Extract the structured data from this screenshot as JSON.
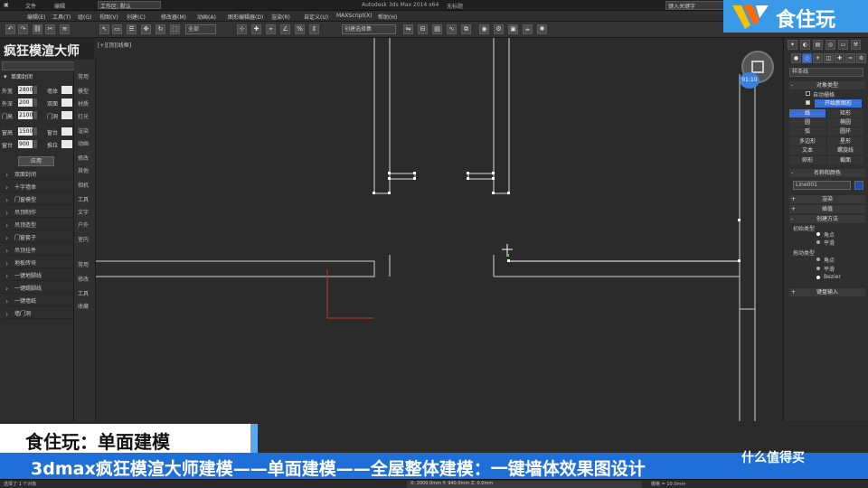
{
  "titlebar": {
    "menu_left": [
      "文件",
      "编辑"
    ],
    "workspace": "工作区: 默认",
    "app_title": "Autodesk 3ds Max 2014 x64",
    "doc_title": "无标题",
    "search_placeholder": "键入关键字"
  },
  "menubar": {
    "items": [
      "编辑(E)",
      "工具(T)",
      "组(G)",
      "视图(V)",
      "创建(C)",
      "修改器(M)",
      "动画(A)",
      "图形编辑器(D)",
      "渲染(R)",
      "自定义(U)",
      "MAXScript(X)",
      "帮助(H)"
    ]
  },
  "toolbar": {
    "selection_filter": "全部",
    "named_selection": "创建选择集"
  },
  "left_panel": {
    "title": "疯狂模渲大师",
    "section": "单面封闭",
    "fields": [
      {
        "l1": "外宽",
        "v1": "2800",
        "l2": "墙体",
        "v2": ""
      },
      {
        "l1": "外深",
        "v1": "200",
        "l2": "双面",
        "v2": ""
      },
      {
        "l1": "门高",
        "v1": "2100",
        "l2": "门洞",
        "v2": ""
      },
      {
        "l1": "窗高",
        "v1": "1500",
        "l2": "窗台",
        "v2": ""
      },
      {
        "l1": "窗台",
        "v1": "900",
        "l2": "推拉",
        "v2": ""
      }
    ],
    "apply_label": "应用",
    "collapsed": [
      "双面封闭",
      "十字墙体",
      "门窗模型",
      "吊顶制作",
      "吊顶造型",
      "门窗套子",
      "吊顶挂件",
      "地板砖块",
      "一键地脚线",
      "一键踢脚线",
      "一键墙纸",
      "墙门洞"
    ]
  },
  "side_column": {
    "items": [
      "常用",
      "模型",
      "材质",
      "灯光",
      "渲染",
      "动画",
      "修改",
      "其他",
      "相机",
      "工具",
      "文字",
      "户外",
      "室内",
      "常用",
      "修改",
      "工具",
      "收藏",
      "帮助"
    ]
  },
  "viewport": {
    "label": "[+][顶][线框]"
  },
  "command_panel": {
    "tabs": [
      "✦",
      "◐",
      "▤",
      "◎",
      "▭",
      "⚒"
    ],
    "object_type_dropdown": "样条线",
    "rollout_object_type": "对象类型",
    "auto_grid": "自动栅格",
    "start_new_shape": "开始新图形",
    "shapes": [
      [
        "线",
        "矩形"
      ],
      [
        "圆",
        "椭圆"
      ],
      [
        "弧",
        "圆环"
      ],
      [
        "多边形",
        "星形"
      ],
      [
        "文本",
        "螺旋线"
      ],
      [
        "卵形",
        "截面"
      ]
    ],
    "rollout_name_color": "名称和颜色",
    "name_value": "Line001",
    "rollout_render": "渲染",
    "rollout_interp": "插值",
    "rollout_create": "创建方法",
    "initial_type": "初始类型",
    "initial_opts": [
      "角点",
      "平滑"
    ],
    "drag_type": "拖动类型",
    "drag_opts": [
      "角点",
      "平滑",
      "Bezier"
    ],
    "rollout_keyboard": "键盘输入"
  },
  "nav": {
    "badge": "01:10"
  },
  "statusbar": {
    "left": "选择了 1 个对象",
    "coords": "X: 2000.0mm  Y: 940.0mm  Z: 0.0mm",
    "grid": "栅格 = 10.0mm"
  },
  "overlay": {
    "logo": "食住玩",
    "banner_top": "食住玩：单面建模",
    "banner_bottom": "3dmax疯狂模渲大师建模——单面建模——全屋整体建模：一键墙体效果图设计",
    "watermark": "什么值得买",
    "colors": {
      "logo_bg": "#3a9ae8",
      "banner_bg": "#1e6fd8",
      "accent": "#3a6fd8"
    }
  }
}
